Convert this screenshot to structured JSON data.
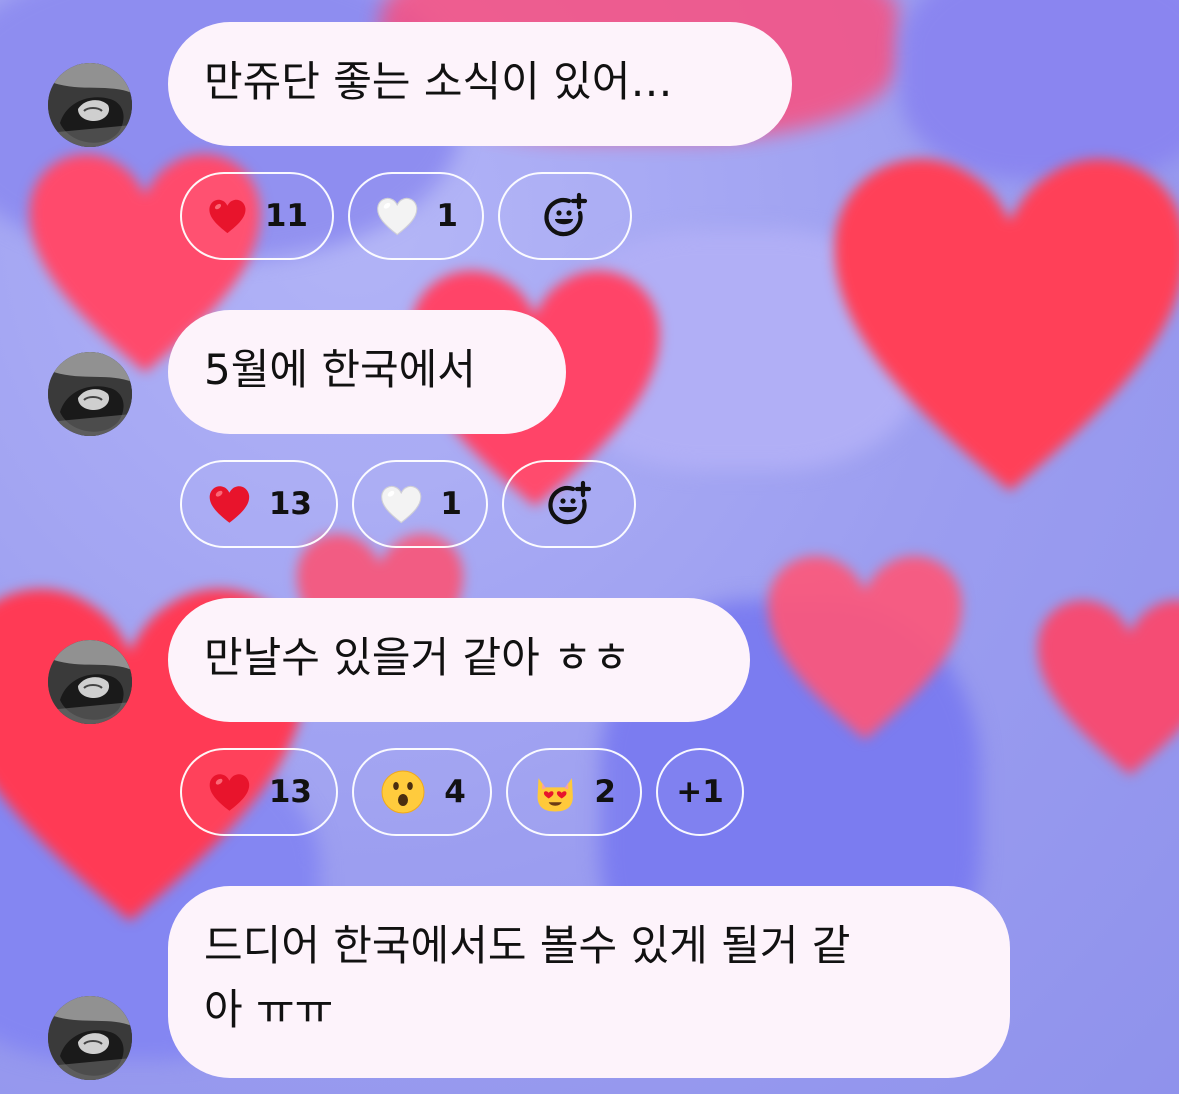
{
  "theme": {
    "bubble_bg": "#fdf3fb",
    "pill_border": "#ffffff",
    "heart_red": "#ff4058",
    "bg_lavender": "#9fa1f2"
  },
  "messages": [
    {
      "text": "만쥬단 좋는 소식이 있어…",
      "reactions": [
        {
          "emoji": "red-heart",
          "count": "11"
        },
        {
          "emoji": "white-heart",
          "count": "1"
        }
      ],
      "add_reaction": "add-reaction-icon"
    },
    {
      "text": "5월에 한국에서",
      "reactions": [
        {
          "emoji": "red-heart",
          "count": "13"
        },
        {
          "emoji": "white-heart",
          "count": "1"
        }
      ],
      "add_reaction": "add-reaction-icon"
    },
    {
      "text": "만날수 있을거 같아 ㅎㅎ",
      "reactions": [
        {
          "emoji": "red-heart",
          "count": "13"
        },
        {
          "emoji": "surprised-face",
          "count": "4"
        },
        {
          "emoji": "heart-eyes-cat",
          "count": "2"
        }
      ],
      "more_reactions": "+1"
    },
    {
      "text_line1": "드디어 한국에서도 볼수 있게 될거 같",
      "text_line2": "아 ㅠㅠ"
    }
  ]
}
